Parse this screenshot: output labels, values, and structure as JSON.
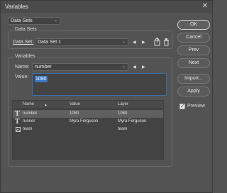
{
  "window": {
    "title": "Variables",
    "close_glyph": "✕"
  },
  "top_combo": {
    "value": "Data Sets"
  },
  "data_sets_group": {
    "legend": "Data Sets",
    "data_set_label": "Data Set:",
    "data_set_value": "Data Set 1"
  },
  "variables_group": {
    "legend": "Variables",
    "name_label": "Name:",
    "name_value": "number",
    "value_label": "Value:",
    "value_text": "1080"
  },
  "table": {
    "headers": {
      "name": "Name",
      "value": "Value",
      "layer": "Layer"
    },
    "rows": [
      {
        "name": "number",
        "value": "1080",
        "layer": "1080",
        "icon": "text-variable-icon"
      },
      {
        "name": "runner",
        "value": "Myra Ferguson",
        "layer": "Myra Ferguson",
        "icon": "text-variable-icon"
      },
      {
        "name": "team",
        "value": "",
        "layer": "team",
        "icon": "pixel-variable-icon"
      }
    ]
  },
  "buttons": {
    "ok": "OK",
    "cancel": "Cancel",
    "prev": "Prev",
    "next": "Next",
    "import": "Import...",
    "apply": "Apply"
  },
  "preview": {
    "label": "Preview",
    "checked": true
  },
  "glyphs": {
    "chevron": "⌄",
    "left": "◀",
    "right": "▶",
    "check": "✓"
  }
}
